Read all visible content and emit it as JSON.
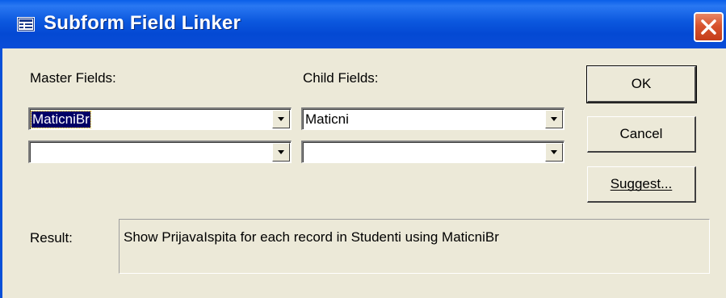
{
  "window": {
    "title": "Subform Field Linker"
  },
  "labels": {
    "master": "Master Fields:",
    "child": "Child Fields:",
    "result": "Result:"
  },
  "master_fields": [
    {
      "value": "MaticniBr"
    },
    {
      "value": ""
    }
  ],
  "child_fields": [
    {
      "value": "Maticni"
    },
    {
      "value": ""
    }
  ],
  "buttons": {
    "ok": "OK",
    "cancel": "Cancel",
    "suggest": "Suggest..."
  },
  "result_text": "Show PrijavaIspita for each record in Studenti using MaticniBr",
  "colors": {
    "titlebar": "#0a5fe8",
    "dialog_bg": "#ece9d8",
    "close_button": "#d8532e",
    "selection": "#000066"
  },
  "icons": {
    "title": "form-icon",
    "close": "close-icon",
    "dropdown": "chevron-down-icon"
  }
}
